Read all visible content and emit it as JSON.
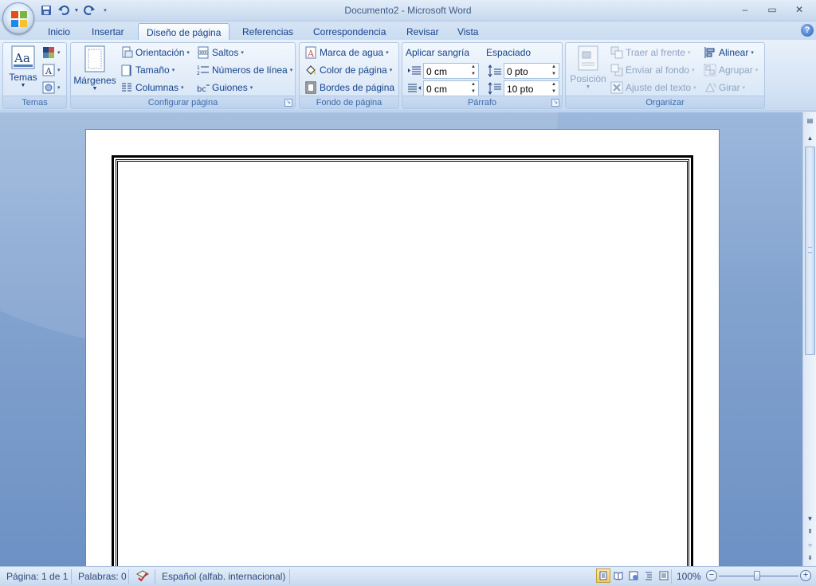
{
  "window": {
    "title": "Documento2 - Microsoft Word",
    "minimize": "–",
    "maximize": "▭",
    "close": "✕"
  },
  "tabs": [
    {
      "label": "Inicio",
      "active": false
    },
    {
      "label": "Insertar",
      "active": false
    },
    {
      "label": "Diseño de página",
      "active": true
    },
    {
      "label": "Referencias",
      "active": false
    },
    {
      "label": "Correspondencia",
      "active": false
    },
    {
      "label": "Revisar",
      "active": false
    },
    {
      "label": "Vista",
      "active": false
    }
  ],
  "help": "?",
  "ribbon": {
    "temas": {
      "label": "Temas",
      "button": "Temas"
    },
    "configurar": {
      "label": "Configurar página",
      "margenes": "Márgenes",
      "orientacion": "Orientación",
      "tamano": "Tamaño",
      "columnas": "Columnas",
      "saltos": "Saltos",
      "numeros_linea": "Números de línea",
      "guiones": "Guiones"
    },
    "fondo": {
      "label": "Fondo de página",
      "marca_agua": "Marca de agua",
      "color_pagina": "Color de página",
      "bordes_pagina": "Bordes de página"
    },
    "parrafo": {
      "label": "Párrafo",
      "sangria_label": "Aplicar sangría",
      "espaciado_label": "Espaciado",
      "sangria_izq": "0 cm",
      "sangria_der": "0 cm",
      "espaciado_antes": "0 pto",
      "espaciado_despues": "10 pto"
    },
    "organizar": {
      "label": "Organizar",
      "posicion": "Posición",
      "traer_frente": "Traer al frente",
      "enviar_fondo": "Enviar al fondo",
      "ajuste_texto": "Ajuste del texto",
      "alinear": "Alinear",
      "agrupar": "Agrupar",
      "girar": "Girar"
    }
  },
  "statusbar": {
    "pagina": "Página: 1 de 1",
    "palabras": "Palabras: 0",
    "idioma": "Español (alfab. internacional)",
    "zoom": "100%",
    "zoom_minus": "−",
    "zoom_plus": "+"
  },
  "colors": {
    "ribbon_text": "#15428b",
    "doc_background": "#83a3cf",
    "active_view": "#f7c95b"
  }
}
